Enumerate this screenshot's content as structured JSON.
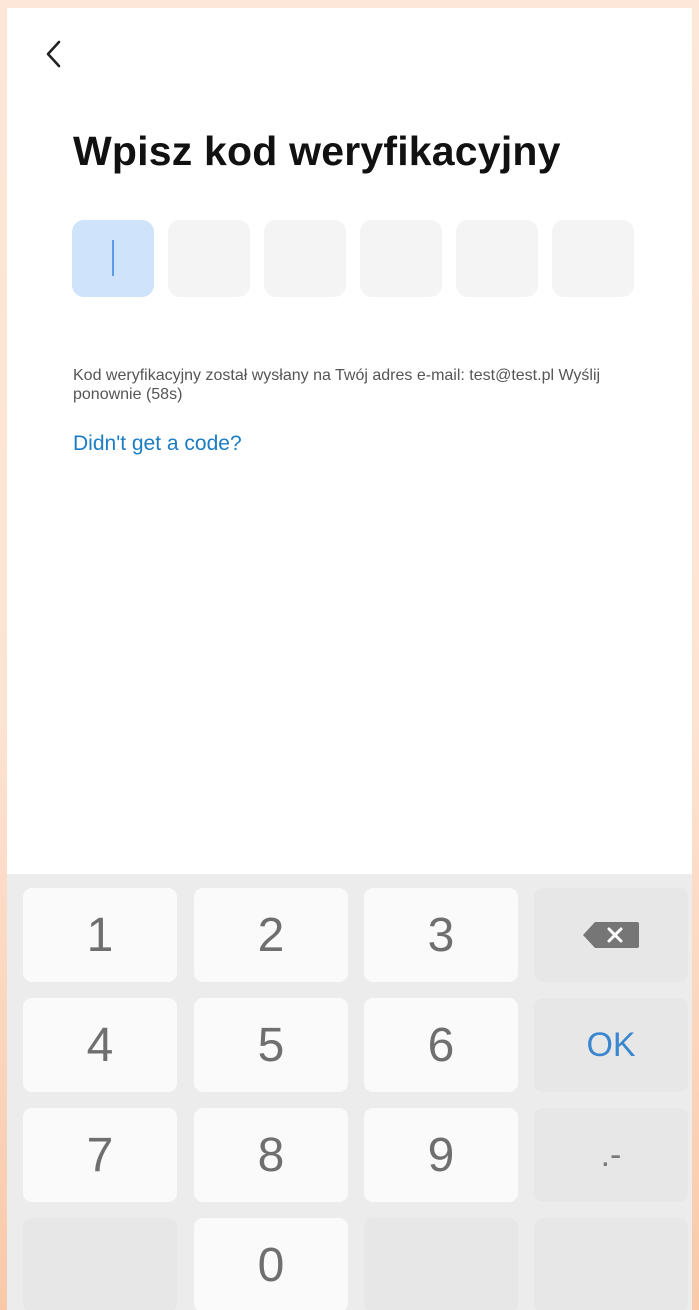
{
  "header": {
    "back_icon": "chevron-left-icon"
  },
  "title": "Wpisz kod weryfikacyjny",
  "code_input": {
    "length": 6,
    "active_index": 0
  },
  "info": {
    "message": "Kod weryfikacyjny został wysłany na Twój adres e-mail: test@test.pl Wyślij ponownie (58s)"
  },
  "resend_link": "Didn't get a code?",
  "keypad": {
    "keys": {
      "k1": "1",
      "k2": "2",
      "k3": "3",
      "k4": "4",
      "k5": "5",
      "k6": "6",
      "k7": "7",
      "k8": "8",
      "k9": "9",
      "k0": "0",
      "ok": "OK",
      "dot_dash": ".-"
    },
    "backspace_icon": "backspace-icon"
  },
  "colors": {
    "accent": "#1b7dc4",
    "active_box": "#cfe3fb",
    "ok_key": "#3a87cf"
  }
}
